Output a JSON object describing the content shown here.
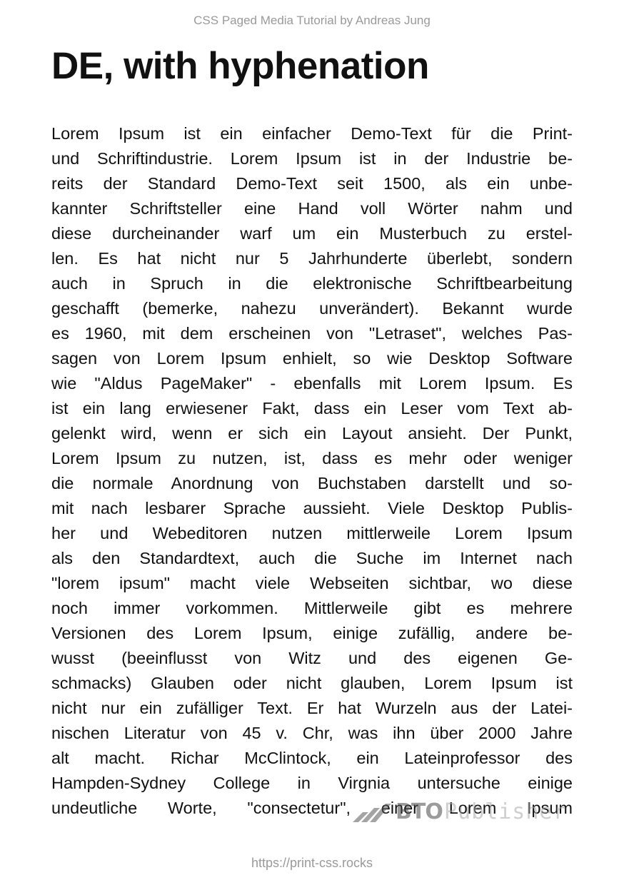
{
  "header": {
    "running_title": "CSS Paged Media Tutorial by Andreas Jung"
  },
  "main": {
    "title": "DE, with hyphenation",
    "lines": [
      "Lorem Ipsum ist ein einfacher Demo-Text für die Print-",
      "und Schriftindustrie. Lorem Ipsum ist in der Industrie be-",
      "reits der Standard Demo-Text seit 1500, als ein unbe-",
      "kannter Schriftsteller eine Hand voll Wörter nahm und",
      "diese durcheinander warf um ein Musterbuch zu erstel-",
      "len. Es hat nicht nur 5 Jahrhunderte überlebt, sondern",
      "auch in Spruch in die elektronische Schriftbearbeitung",
      "geschafft (bemerke, nahezu unverändert). Bekannt wurde",
      "es 1960, mit dem erscheinen von \"Letraset\", welches Pas-",
      "sagen von Lorem Ipsum enhielt, so wie Desktop Software",
      "wie \"Aldus PageMaker\" - ebenfalls mit Lorem Ipsum. Es",
      "ist ein lang erwiesener Fakt, dass ein Leser vom Text ab-",
      "gelenkt wird, wenn er sich ein Layout ansieht. Der Punkt,",
      "Lorem Ipsum zu nutzen, ist, dass es mehr oder weniger",
      "die normale Anordnung von Buchstaben darstellt und so-",
      "mit nach lesbarer Sprache aussieht. Viele Desktop Publis-",
      "her und Webeditoren nutzen mittlerweile Lorem Ipsum",
      "als den Standardtext, auch die Suche im Internet nach",
      "\"lorem ipsum\" macht viele Webseiten sichtbar, wo diese",
      "noch immer vorkommen. Mittlerweile gibt es mehrere",
      "Versionen des Lorem Ipsum, einige zufällig, andere be-",
      "wusst (beeinflusst von Witz und des eigenen Ge-",
      "schmacks) Glauben oder nicht glauben, Lorem Ipsum ist",
      "nicht nur ein zufälliger Text. Er hat Wurzeln aus der Latei-",
      "nischen Literatur von 45 v. Chr, was ihn über 2000 Jahre",
      "alt macht. Richar McClintock, ein Lateinprofessor des",
      "Hampden-Sydney College in Virgnia untersuche einige",
      "undeutliche Worte, \"consectetur\", einer Lorem Ipsum"
    ]
  },
  "watermark": {
    "brand_bold": "BTO",
    "brand_light": "Publisher",
    "logo_icon": "stripes-logo-icon"
  },
  "footer": {
    "url": "https://print-css.rocks"
  }
}
